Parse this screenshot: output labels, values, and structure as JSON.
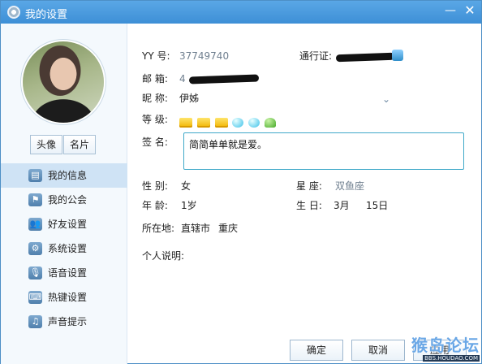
{
  "window": {
    "title": "我的设置"
  },
  "sidebar": {
    "buttons": [
      "头像",
      "名片"
    ],
    "items": [
      {
        "label": "我的信息",
        "icon": "profile-card-icon",
        "active": true
      },
      {
        "label": "我的公会",
        "icon": "flag-icon",
        "active": false
      },
      {
        "label": "好友设置",
        "icon": "friends-gear-icon",
        "active": false
      },
      {
        "label": "系统设置",
        "icon": "gear-icon",
        "active": false
      },
      {
        "label": "语音设置",
        "icon": "microphone-icon",
        "active": false
      },
      {
        "label": "热键设置",
        "icon": "keyboard-icon",
        "active": false
      },
      {
        "label": "声音提示",
        "icon": "music-note-icon",
        "active": false
      }
    ]
  },
  "profile": {
    "yy": {
      "label": "YY  号:",
      "value": "37749740"
    },
    "pass": {
      "label": "通行证:"
    },
    "email": {
      "label": "邮 箱:",
      "value": "4"
    },
    "nickname": {
      "label": "昵 称:",
      "value": "伊姊"
    },
    "level": {
      "label": "等 级:"
    },
    "signature": {
      "label": "签 名:",
      "value": "简简单单就是爱。"
    },
    "gender": {
      "label": "性 别:",
      "value": "女"
    },
    "zodiac": {
      "label": "星 座:",
      "value": "双鱼座"
    },
    "age": {
      "label": "年 龄:",
      "value": "1岁"
    },
    "birthday": {
      "label": "生 日:",
      "month": "3月",
      "day": "15日"
    },
    "location": {
      "label": "所在地:",
      "province": "直辖市",
      "city": "重庆"
    },
    "bio": {
      "label": "个人说明:"
    }
  },
  "footer": {
    "ok": "确定",
    "cancel": "取消",
    "apply": "应用"
  },
  "watermark": {
    "main": "猴岛论坛",
    "sub": "BBS.HOUDAO.COM"
  },
  "colors": {
    "title_bar": "#3d8fd6",
    "active_nav": "#cfe3f5",
    "signature_border": "#40a9c9"
  }
}
